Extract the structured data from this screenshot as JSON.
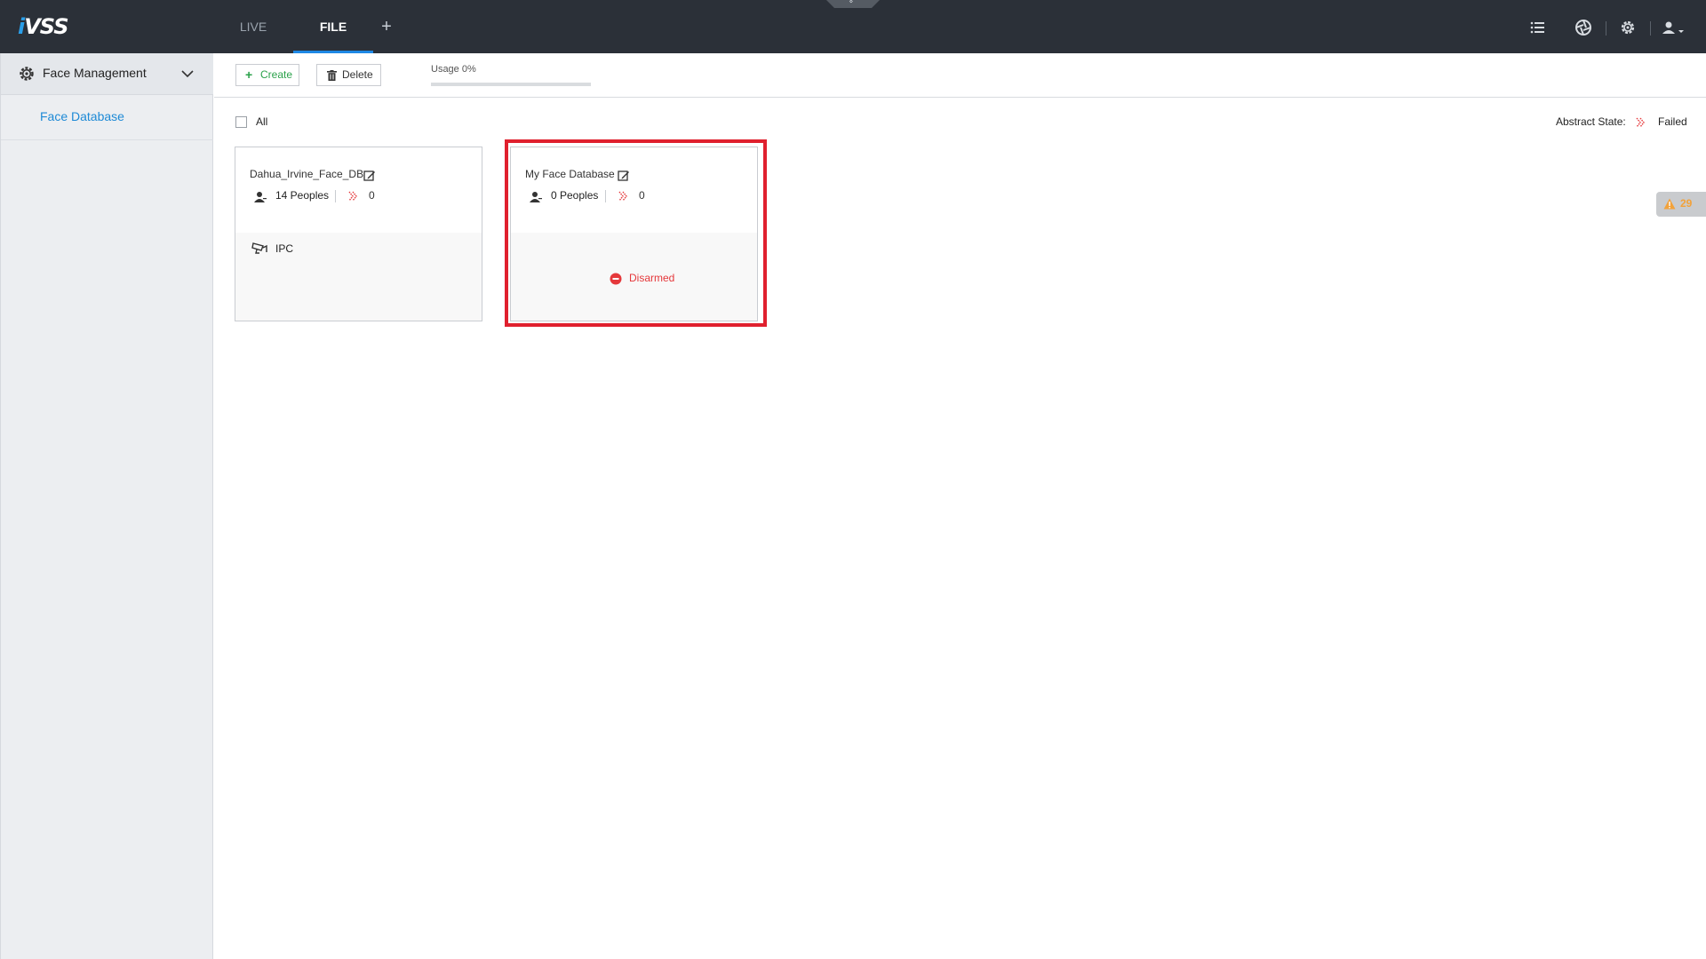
{
  "app": {
    "logo_prefix": "i",
    "logo_rest": "VSS"
  },
  "tabs": [
    {
      "label": "LIVE",
      "active": false
    },
    {
      "label": "FILE",
      "active": true
    }
  ],
  "add_tab_label": "+",
  "pull_tab_glyph": "»",
  "top_icons": [
    "list-icon",
    "aperture-icon",
    "settings-gear-icon",
    "user-menu-icon"
  ],
  "sidebar": {
    "section_title": "Face Management",
    "items": [
      {
        "label": "Face Database",
        "selected": true
      }
    ]
  },
  "toolbar": {
    "create_label": "Create",
    "create_glyph": "+",
    "delete_label": "Delete",
    "usage_label": "Usage 0%",
    "usage_percent": 0
  },
  "content": {
    "all_label": "All",
    "abstract_state_label": "Abstract State:",
    "abstract_state_value": "Failed"
  },
  "databases": [
    {
      "name": "Dahua_Irvine_Face_DB",
      "peoples": "14 Peoples",
      "failed_count": "0",
      "source": "IPC"
    },
    {
      "name": "My Face Database",
      "peoples": "0 Peoples",
      "failed_count": "0",
      "status": "Disarmed",
      "highlighted": true
    }
  ],
  "alert": {
    "count": "29"
  },
  "colors": {
    "topbar": "#2b3038",
    "accent": "#1e88e5",
    "create": "#2aa14a",
    "danger": "#e5383b",
    "highlight": "#e0202e",
    "warning": "#f2a23a"
  }
}
